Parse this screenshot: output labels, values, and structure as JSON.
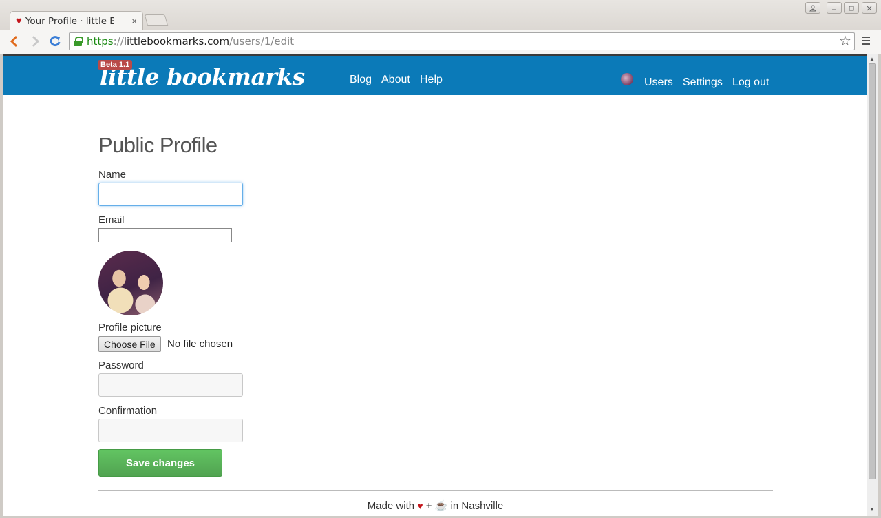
{
  "browser": {
    "tab": {
      "title": "Your Profile · little B",
      "close_label": "×"
    },
    "url": {
      "scheme": "https",
      "separator": "://",
      "host": "littlebookmarks.com",
      "path": "/users/1/edit"
    }
  },
  "site": {
    "logo": "little bookmarks",
    "badge": "Beta 1.1",
    "nav": {
      "blog": "Blog",
      "about": "About",
      "help": "Help"
    },
    "user_nav": {
      "users": "Users",
      "settings": "Settings",
      "logout": "Log out"
    }
  },
  "form": {
    "title": "Public Profile",
    "name_label": "Name",
    "name_value": "",
    "email_label": "Email",
    "email_value": "",
    "picture_label": "Profile picture",
    "choose_file": "Choose File",
    "file_status": "No file chosen",
    "password_label": "Password",
    "confirmation_label": "Confirmation",
    "save": "Save changes"
  },
  "footer": {
    "made_with": "Made with",
    "heart": "♥",
    "plus": "+",
    "coffee": "☕",
    "location": "in Nashville"
  },
  "colors": {
    "header": "#0b7ab8",
    "save": "#5bb75b",
    "badge": "#b94a48",
    "secure": "#1a8a12"
  }
}
